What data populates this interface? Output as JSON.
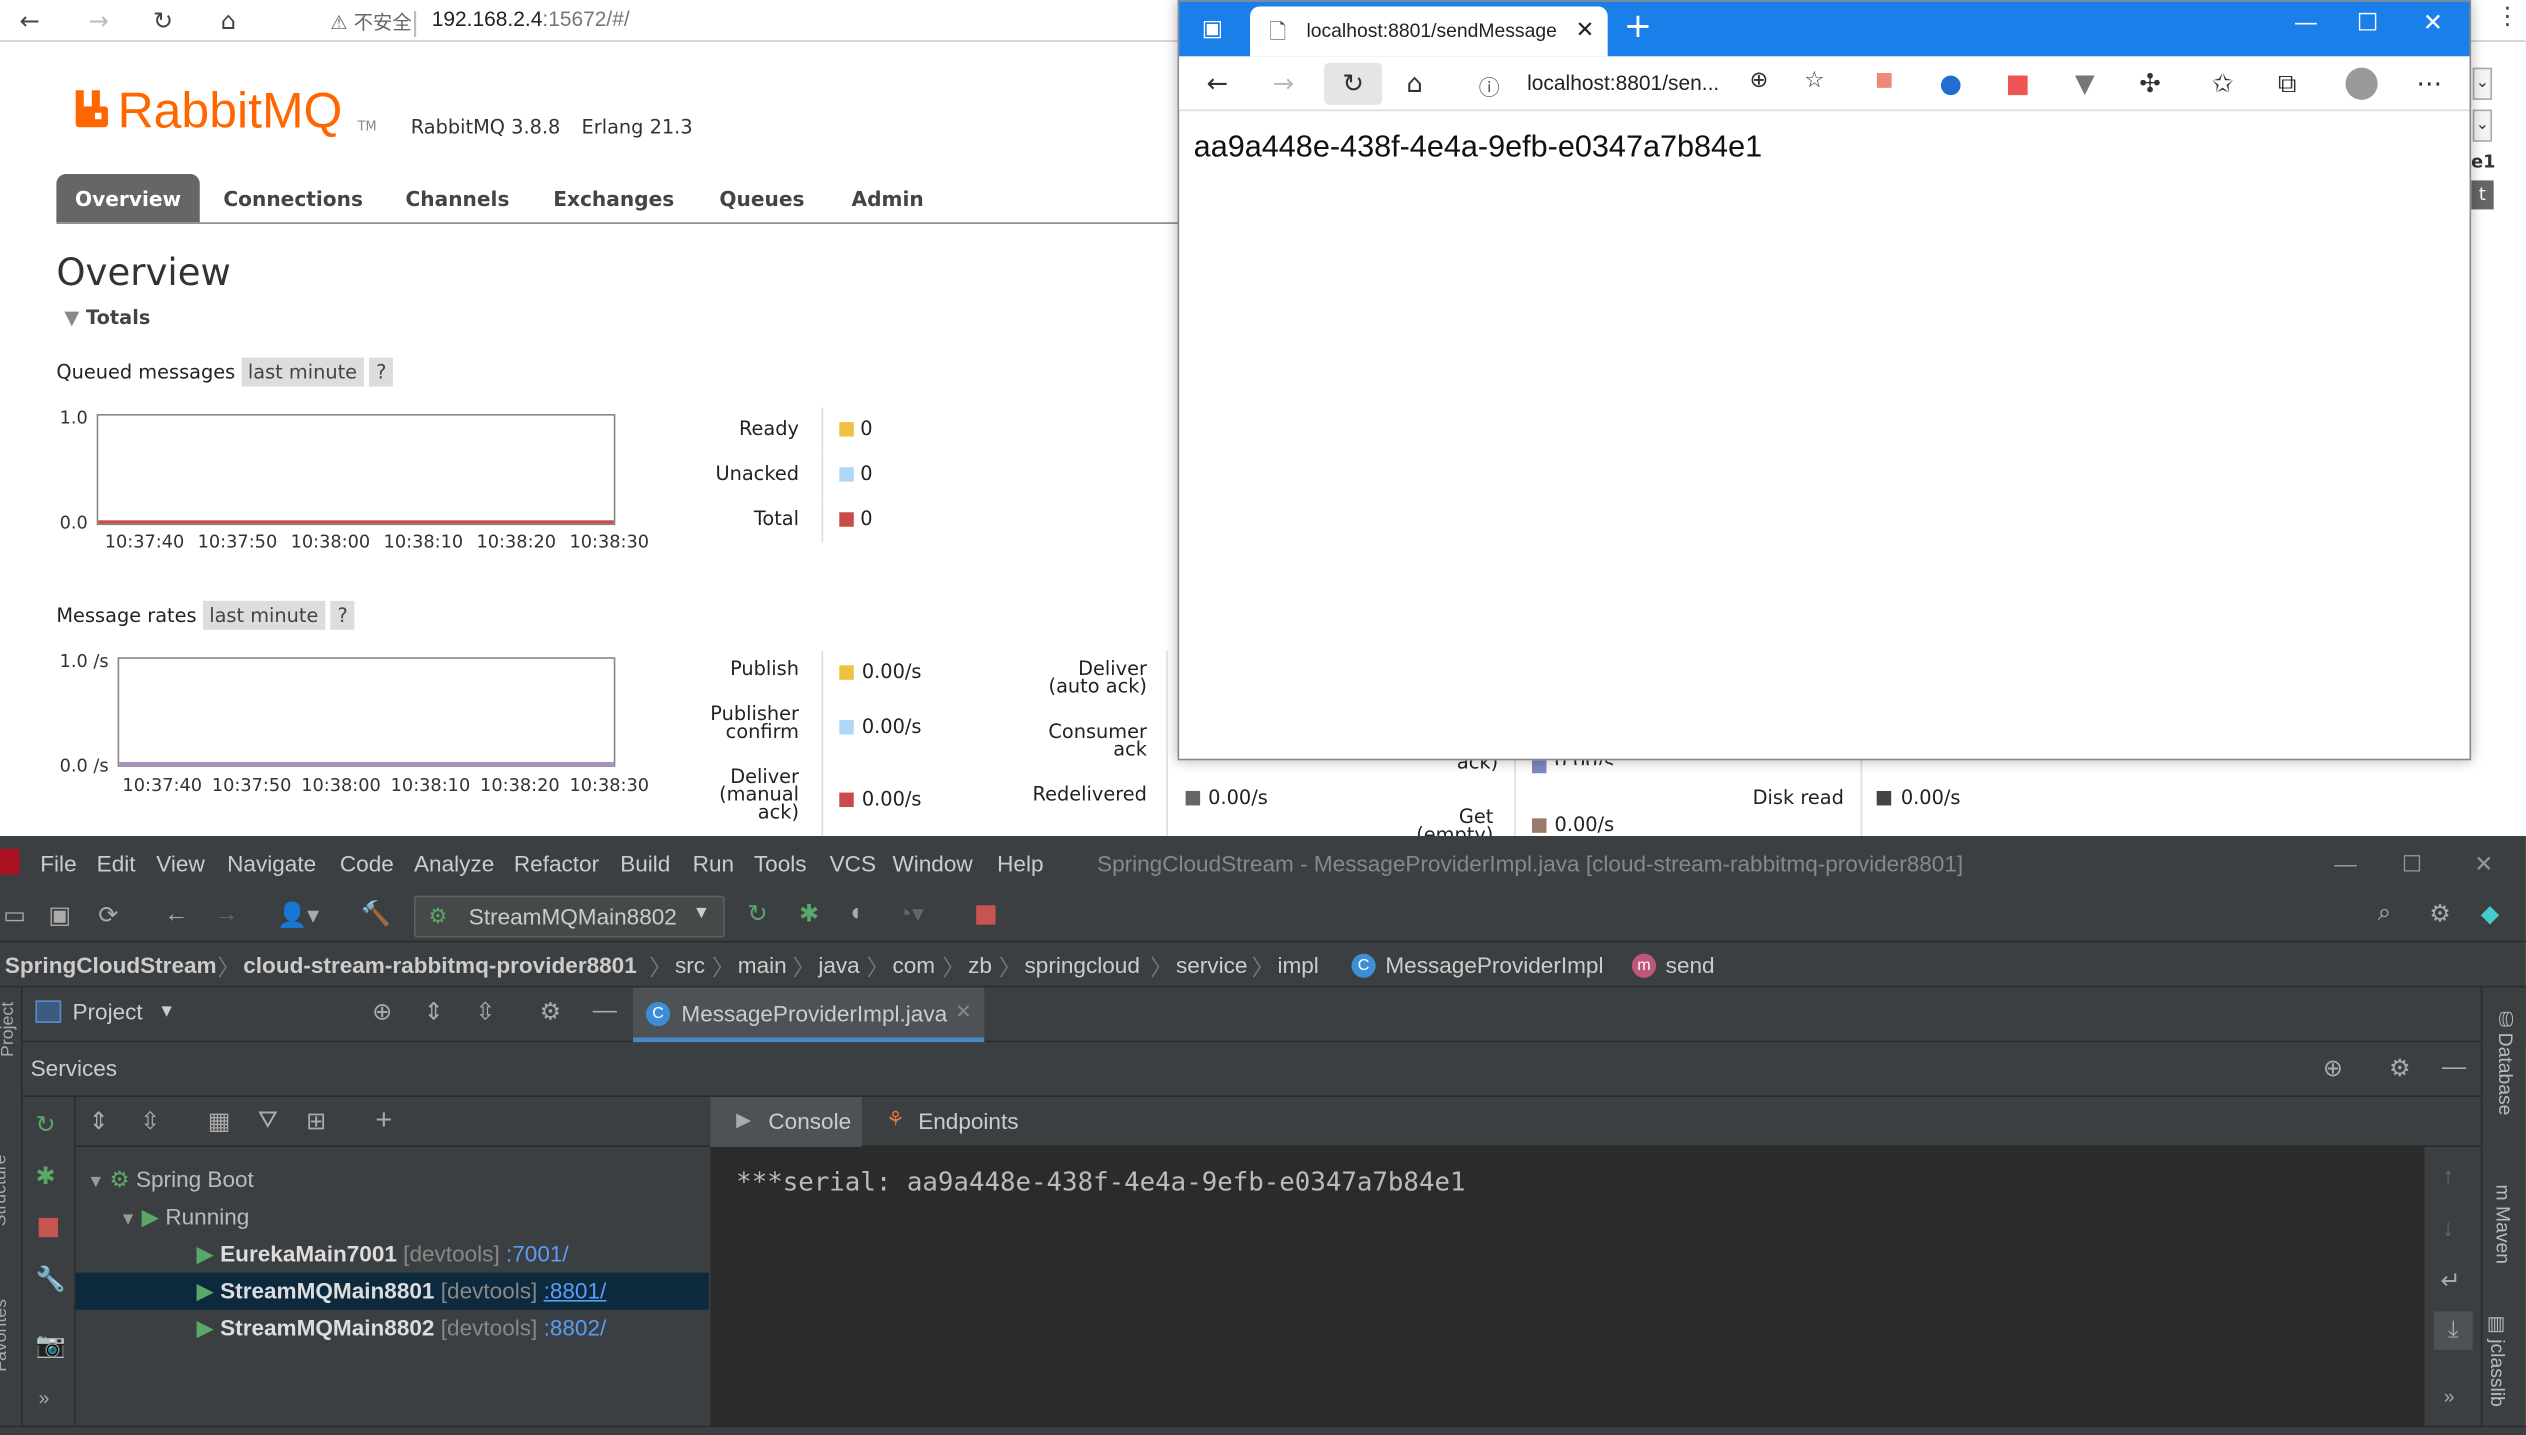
{
  "browser1": {
    "security": "不安全",
    "url_host": "192.168.2.4",
    "url_rest": ":15672/#/"
  },
  "rabbitmq": {
    "logo": "RabbitMQ",
    "tm": "TM",
    "version": "RabbitMQ 3.8.8",
    "erlang": "Erlang 21.3",
    "tabs": [
      "Overview",
      "Connections",
      "Channels",
      "Exchanges",
      "Queues",
      "Admin"
    ],
    "title": "Overview",
    "totals": "Totals",
    "queued": {
      "label": "Queued messages",
      "range": "last minute",
      "help": "?",
      "ymax": "1.0",
      "ymin": "0.0",
      "xticks": [
        "10:37:40",
        "10:37:50",
        "10:38:00",
        "10:38:10",
        "10:38:20",
        "10:38:30"
      ],
      "legend": [
        {
          "name": "Ready",
          "value": "0",
          "color": "#edc240"
        },
        {
          "name": "Unacked",
          "value": "0",
          "color": "#afd8f8"
        },
        {
          "name": "Total",
          "value": "0",
          "color": "#cb4b4b"
        }
      ]
    },
    "rates": {
      "label": "Message rates",
      "range": "last minute",
      "help": "?",
      "ymax": "1.0 /s",
      "ymin": "0.0 /s",
      "xticks": [
        "10:37:40",
        "10:37:50",
        "10:38:00",
        "10:38:10",
        "10:38:20",
        "10:38:30"
      ],
      "col1": [
        {
          "name": "Publish",
          "value": "0.00/s",
          "color": "#edc240"
        },
        {
          "name": "Publisher\nconfirm",
          "value": "0.00/s",
          "color": "#afd8f8"
        },
        {
          "name": "Deliver\n(manual\nack)",
          "value": "0.00/s",
          "color": "#cb4b4b"
        }
      ],
      "col2": [
        {
          "name": "Deliver\n(auto ack)"
        },
        {
          "name": "Consumer\nack"
        },
        {
          "name": "Redelivered",
          "value": "0.00/s",
          "color": "#666666"
        }
      ],
      "partial": {
        "ack": "ack)",
        "get": "Get",
        "get2": "(empty)",
        "v1": "0.00/s",
        "v2": "0.00/s",
        "disk": "Disk read",
        "disk_value": "0.00/s"
      }
    },
    "right_edge": {
      "e1": "e1",
      "t": "t"
    }
  },
  "browser2": {
    "tab_title": "localhost:8801/sendMessage",
    "url": "localhost:8801/sen...",
    "body": "aa9a448e-438f-4e4a-9efb-e0347a7b84e1"
  },
  "ide": {
    "menu": [
      "File",
      "Edit",
      "View",
      "Navigate",
      "Code",
      "Analyze",
      "Refactor",
      "Build",
      "Run",
      "Tools",
      "VCS",
      "Window",
      "Help"
    ],
    "window_title": "SpringCloudStream - MessageProviderImpl.java [cloud-stream-rabbitmq-provider8801]",
    "run_config": "StreamMQMain8802",
    "breadcrumbs": [
      "SpringCloudStream",
      "cloud-stream-rabbitmq-provider8801",
      "src",
      "main",
      "java",
      "com",
      "zb",
      "springcloud",
      "service",
      "impl",
      "MessageProviderImpl",
      "send"
    ],
    "project_label": "Project",
    "editor_tab": "MessageProviderImpl.java",
    "services_title": "Services",
    "tree": {
      "root": "Spring Boot",
      "running": "Running",
      "apps": [
        {
          "name": "EurekaMain7001",
          "tag": "[devtools]",
          "port": ":7001/"
        },
        {
          "name": "StreamMQMain8801",
          "tag": "[devtools]",
          "port": ":8801/"
        },
        {
          "name": "StreamMQMain8802",
          "tag": "[devtools]",
          "port": ":8802/"
        }
      ]
    },
    "console_tabs": [
      "Console",
      "Endpoints"
    ],
    "console_output": "***serial: aa9a448e-438f-4e4a-9efb-e0347a7b84e1",
    "right_tools": [
      "Database",
      "Maven",
      "jclasslib"
    ],
    "left_tools": [
      "Project",
      "Structure",
      "Favorites"
    ]
  }
}
